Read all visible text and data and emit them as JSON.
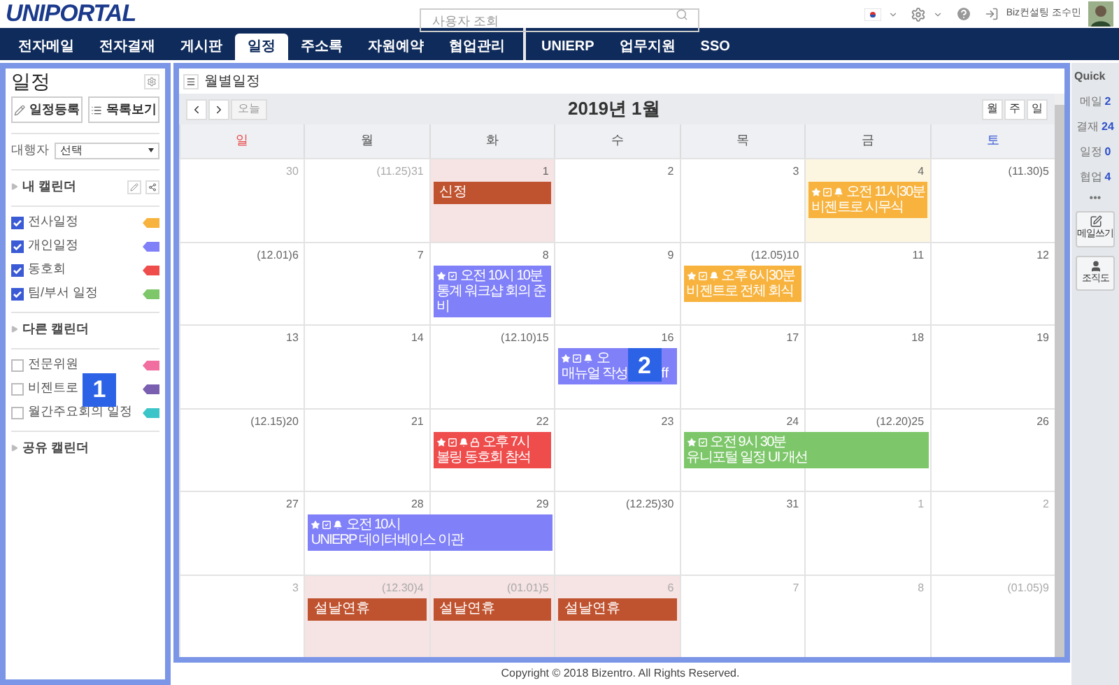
{
  "header": {
    "logo": "UNIPORTAL",
    "search": {
      "placeholder": "사용자 조회"
    },
    "user": "Biz컨설팅 조수민"
  },
  "nav": {
    "groups": [
      [
        {
          "label": "전자메일",
          "selected": false
        },
        {
          "label": "전자결재",
          "selected": false
        },
        {
          "label": "게시판",
          "selected": false
        },
        {
          "label": "일정",
          "selected": true
        },
        {
          "label": "주소록",
          "selected": false
        },
        {
          "label": "자원예약",
          "selected": false
        },
        {
          "label": "협업관리",
          "selected": false
        }
      ],
      [
        {
          "label": "UNIERP",
          "selected": false
        },
        {
          "label": "업무지원",
          "selected": false
        },
        {
          "label": "SSO",
          "selected": false
        }
      ]
    ]
  },
  "sidebar": {
    "title": "일정",
    "buttons": [
      "일정등록",
      "목록보기"
    ],
    "delegate": {
      "label": "대행자",
      "value": "선택"
    },
    "sections": [
      {
        "title": "내 캘린더",
        "tools": true,
        "items": [
          {
            "label": "전사일정",
            "checked": true,
            "color": "#f7b33e"
          },
          {
            "label": "개인일정",
            "checked": true,
            "color": "#8080f8"
          },
          {
            "label": "동호회",
            "checked": true,
            "color": "#ef4c4c"
          },
          {
            "label": "팀/부서 일정",
            "checked": true,
            "color": "#7dc76a"
          }
        ]
      },
      {
        "title": "다른 캘린더",
        "tools": false,
        "items": [
          {
            "label": "전문위원",
            "checked": false,
            "color": "#f06fa0"
          },
          {
            "label": "비젠트로",
            "checked": false,
            "color": "#7a5fb0",
            "marker": "1"
          },
          {
            "label": "월간주요회의 일정",
            "checked": false,
            "color": "#3cc5c8"
          }
        ]
      },
      {
        "title": "공유 캘린더",
        "tools": false
      }
    ]
  },
  "main": {
    "title": "월별일정",
    "today_button": "오늘",
    "month": "2019년 1월",
    "views": [
      "월",
      "주",
      "일"
    ],
    "weekdays": [
      {
        "label": "일",
        "color": "#e84b4b"
      },
      {
        "label": "월",
        "color": "#555555"
      },
      {
        "label": "화",
        "color": "#555555"
      },
      {
        "label": "수",
        "color": "#555555"
      },
      {
        "label": "목",
        "color": "#555555"
      },
      {
        "label": "금",
        "color": "#555555"
      },
      {
        "label": "토",
        "color": "#3b5bd6"
      }
    ],
    "weeks": [
      {
        "days": [
          {
            "date": "30",
            "other_month": true,
            "kind": "normal"
          },
          {
            "date": "(11.25)31",
            "other_month": true,
            "kind": "normal"
          },
          {
            "date": "1",
            "other_month": false,
            "kind": "holiday",
            "events": [
              {
                "kind": "holiday",
                "title": "신정",
                "color": "#c0532f"
              }
            ]
          },
          {
            "date": "2",
            "other_month": false,
            "kind": "normal"
          },
          {
            "date": "3",
            "other_month": false,
            "kind": "normal"
          },
          {
            "date": "4",
            "other_month": false,
            "kind": "today",
            "events": [
              {
                "kind": "schedule",
                "color": "#f7b33e",
                "multi_day": false,
                "starred": true,
                "checked": true,
                "alarm": true,
                "locked": false,
                "time": "오전 11시30분",
                "title": "비젠트로 시무식"
              }
            ]
          },
          {
            "date": "(11.30)5",
            "other_month": false,
            "kind": "normal"
          }
        ]
      },
      {
        "days": [
          {
            "date": "(12.01)6",
            "other_month": false,
            "kind": "normal"
          },
          {
            "date": "7",
            "other_month": false,
            "kind": "normal"
          },
          {
            "date": "8",
            "other_month": false,
            "kind": "normal",
            "events": [
              {
                "kind": "schedule",
                "color": "#8080f8",
                "multi_day": false,
                "starred": true,
                "checked": true,
                "alarm": false,
                "locked": false,
                "time": "오전 10시 10분",
                "title": "통계 워크샵 회의 준비"
              }
            ]
          },
          {
            "date": "9",
            "other_month": false,
            "kind": "normal"
          },
          {
            "date": "(12.05)10",
            "other_month": false,
            "kind": "normal",
            "events": [
              {
                "kind": "schedule",
                "color": "#f7b33e",
                "multi_day": false,
                "starred": true,
                "checked": true,
                "alarm": true,
                "locked": false,
                "time": "오후 6시30분",
                "title": "비젠트로 전체 회식"
              }
            ]
          },
          {
            "date": "11",
            "other_month": false,
            "kind": "normal"
          },
          {
            "date": "12",
            "other_month": false,
            "kind": "normal"
          }
        ]
      },
      {
        "days": [
          {
            "date": "13",
            "other_month": false,
            "kind": "normal"
          },
          {
            "date": "14",
            "other_month": false,
            "kind": "normal"
          },
          {
            "date": "(12.10)15",
            "other_month": false,
            "kind": "normal"
          },
          {
            "date": "16",
            "other_month": false,
            "kind": "normal",
            "events": [
              {
                "kind": "schedule",
                "color": "#8080f8",
                "multi_day": false,
                "starred": true,
                "checked": true,
                "alarm": true,
                "locked": false,
                "time": "오",
                "title": "매뉴얼 작성",
                "title_tail": "ff",
                "marker": "2"
              }
            ]
          },
          {
            "date": "17",
            "other_month": false,
            "kind": "normal"
          },
          {
            "date": "18",
            "other_month": false,
            "kind": "normal"
          },
          {
            "date": "19",
            "other_month": false,
            "kind": "normal"
          }
        ]
      },
      {
        "days": [
          {
            "date": "(12.15)20",
            "other_month": false,
            "kind": "normal"
          },
          {
            "date": "21",
            "other_month": false,
            "kind": "normal"
          },
          {
            "date": "22",
            "other_month": false,
            "kind": "normal",
            "events": [
              {
                "kind": "schedule",
                "color": "#ef4c4c",
                "multi_day": false,
                "starred": true,
                "checked": true,
                "alarm": true,
                "locked": true,
                "time": "오후 7시",
                "title": "볼링 동호회 참석"
              }
            ]
          },
          {
            "date": "23",
            "other_month": false,
            "kind": "normal"
          },
          {
            "date": "24",
            "other_month": false,
            "kind": "normal",
            "events": [
              {
                "kind": "schedule",
                "color": "#7dc76a",
                "multi_day": true,
                "starred": true,
                "checked": true,
                "alarm": false,
                "locked": false,
                "time": "오전 9시 30분",
                "title": "유니포털 일정 UI 개선"
              }
            ]
          },
          {
            "date": "(12.20)25",
            "other_month": false,
            "kind": "normal"
          },
          {
            "date": "26",
            "other_month": false,
            "kind": "normal"
          }
        ]
      },
      {
        "days": [
          {
            "date": "27",
            "other_month": false,
            "kind": "normal"
          },
          {
            "date": "28",
            "other_month": false,
            "kind": "normal",
            "events": [
              {
                "kind": "schedule",
                "color": "#8080f8",
                "multi_day": true,
                "starred": true,
                "checked": true,
                "alarm": true,
                "locked": false,
                "time": "오전 10시",
                "title": "UNIERP 데이터베이스 이관"
              }
            ]
          },
          {
            "date": "29",
            "other_month": false,
            "kind": "normal"
          },
          {
            "date": "(12.25)30",
            "other_month": false,
            "kind": "normal"
          },
          {
            "date": "31",
            "other_month": false,
            "kind": "normal"
          },
          {
            "date": "1",
            "other_month": true,
            "kind": "normal"
          },
          {
            "date": "2",
            "other_month": true,
            "kind": "normal"
          }
        ]
      },
      {
        "days": [
          {
            "date": "3",
            "other_month": true,
            "kind": "normal"
          },
          {
            "date": "(12.30)4",
            "other_month": true,
            "kind": "holiday",
            "events": [
              {
                "kind": "holiday",
                "title": "설날연휴",
                "color": "#c0532f"
              }
            ]
          },
          {
            "date": "(01.01)5",
            "other_month": true,
            "kind": "holiday",
            "events": [
              {
                "kind": "holiday",
                "title": "설날연휴",
                "color": "#c0532f"
              }
            ]
          },
          {
            "date": "6",
            "other_month": true,
            "kind": "holiday",
            "events": [
              {
                "kind": "holiday",
                "title": "설날연휴",
                "color": "#c0532f"
              }
            ]
          },
          {
            "date": "7",
            "other_month": true,
            "kind": "normal"
          },
          {
            "date": "8",
            "other_month": true,
            "kind": "normal"
          },
          {
            "date": "(01.05)9",
            "other_month": true,
            "kind": "normal"
          }
        ]
      }
    ]
  },
  "quick": {
    "title": "Quick",
    "counts": [
      {
        "label": "메일",
        "count": "2"
      },
      {
        "label": "결재",
        "count": "24"
      },
      {
        "label": "일정",
        "count": "0"
      },
      {
        "label": "협업",
        "count": "4"
      }
    ],
    "more": "•••",
    "buttons": [
      {
        "kind": "write",
        "label": "메일쓰기"
      },
      {
        "kind": "org",
        "label": "조직도"
      }
    ]
  },
  "footer": "Copyright © 2018 Bizentro. All Rights Reserved."
}
